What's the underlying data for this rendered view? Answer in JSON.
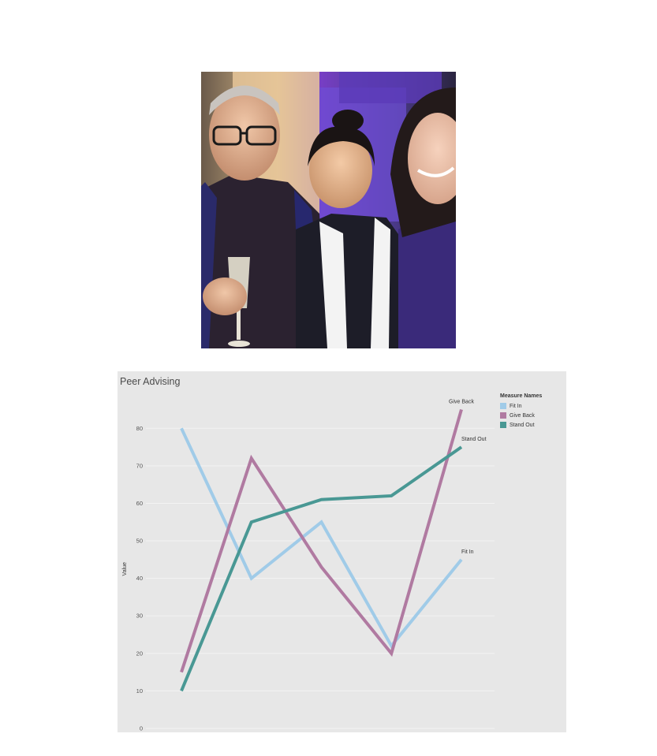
{
  "colors": {
    "fit_in": "#a0cbe8",
    "give_back": "#b07aa1",
    "stand_out": "#499894"
  },
  "chart_data": {
    "type": "line",
    "title": "Peer Advising",
    "ylabel": "Value",
    "xlabel": "",
    "ylim": [
      0,
      85
    ],
    "yticks": [
      0,
      10,
      20,
      30,
      40,
      50,
      60,
      70,
      80
    ],
    "x": [
      1,
      2,
      3,
      4,
      5
    ],
    "grid": true,
    "legend": {
      "title": "Measure Names",
      "placement": "right",
      "entries": [
        "Fit In",
        "Give Back",
        "Stand Out"
      ]
    },
    "series": [
      {
        "name": "Fit In",
        "values": [
          80,
          40,
          55,
          22,
          45
        ],
        "color": "#a0cbe8"
      },
      {
        "name": "Give Back",
        "values": [
          15,
          72,
          43,
          20,
          85
        ],
        "color": "#b07aa1"
      },
      {
        "name": "Stand Out",
        "values": [
          10,
          55,
          61,
          62,
          75
        ],
        "color": "#499894"
      }
    ]
  }
}
